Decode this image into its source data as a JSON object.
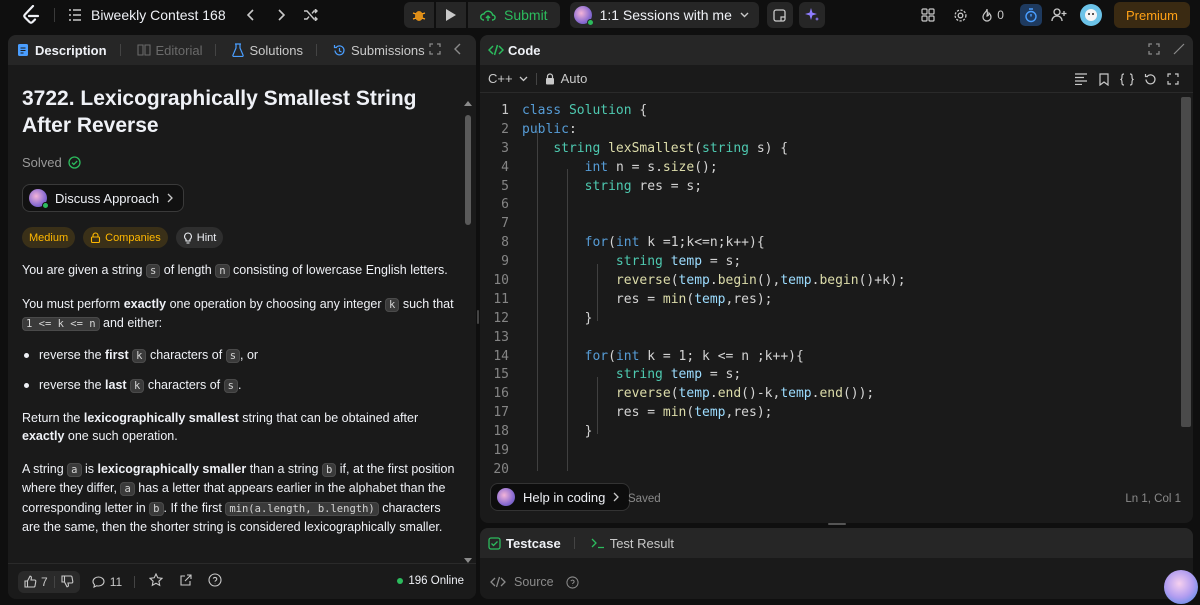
{
  "topbar": {
    "contest_title": "Biweekly Contest 168",
    "submit_label": "Submit",
    "sessions_label": "1:1 Sessions with me",
    "streak_count": "0",
    "premium_label": "Premium"
  },
  "left": {
    "tabs": [
      {
        "label": "Description"
      },
      {
        "label": "Editorial"
      },
      {
        "label": "Solutions"
      },
      {
        "label": "Submissions"
      }
    ],
    "title": "3722. Lexicographically Smallest String After Reverse",
    "solved_label": "Solved",
    "discuss_label": "Discuss Approach",
    "tags": {
      "difficulty": "Medium",
      "companies": "Companies",
      "hint": "Hint"
    },
    "p1": {
      "a": "You are given a string",
      "s": "s",
      "b": "of length",
      "n": "n",
      "c": "consisting of lowercase English letters."
    },
    "p2": {
      "a": "You must perform",
      "exactly": "exactly",
      "b": "one operation by choosing any integer",
      "k": "k",
      "c": "such that",
      "range": "1 <= k <= n",
      "d": "and either:"
    },
    "bullet1": {
      "a": "reverse the",
      "first": "first",
      "k": "k",
      "b": "characters of",
      "s": "s",
      "c": ", or"
    },
    "bullet2": {
      "a": "reverse the",
      "last": "last",
      "k": "k",
      "b": "characters of",
      "s": "s",
      "c": "."
    },
    "p3": {
      "a": "Return the",
      "lex": "lexicographically smallest",
      "b": "string that can be obtained after",
      "exactly": "exactly",
      "c": "one such operation."
    },
    "p4": {
      "a": "A string",
      "sa": "a",
      "b": "is",
      "lex": "lexicographically smaller",
      "c": "than a string",
      "sb": "b",
      "d": "if, at the first position where they differ,",
      "sa2": "a",
      "e": "has a letter that appears earlier in the alphabet than the corresponding letter in",
      "sb2": "b",
      "f": ". If the first",
      "minexpr": "min(a.length, b.length)",
      "g": "characters are the same, then the shorter string is considered lexicographically smaller."
    },
    "footer": {
      "likes": "7",
      "comments": "11",
      "online": "196 Online"
    }
  },
  "right": {
    "title": "Code",
    "language": "C++",
    "mode": "Auto",
    "code_lines": [
      "class Solution {",
      "public:",
      "    string lexSmallest(string s) {",
      "        int n = s.size();",
      "        string res = s;",
      "",
      "",
      "        for(int k =1;k<=n;k++){",
      "            string temp = s;",
      "            reverse(temp.begin(),temp.begin()+k);",
      "            res = min(temp,res);",
      "        }",
      "",
      "        for(int k = 1; k <= n ;k++){",
      "            string temp = s;",
      "            reverse(temp.end()-k,temp.end());",
      "            res = min(temp,res);",
      "        }",
      "",
      ""
    ],
    "help_label": "Help in coding",
    "saved_label": "Saved",
    "cursor_pos": "Ln 1, Col 1",
    "bottom_tabs": {
      "testcase": "Testcase",
      "result": "Test Result"
    },
    "source_label": "Source"
  }
}
